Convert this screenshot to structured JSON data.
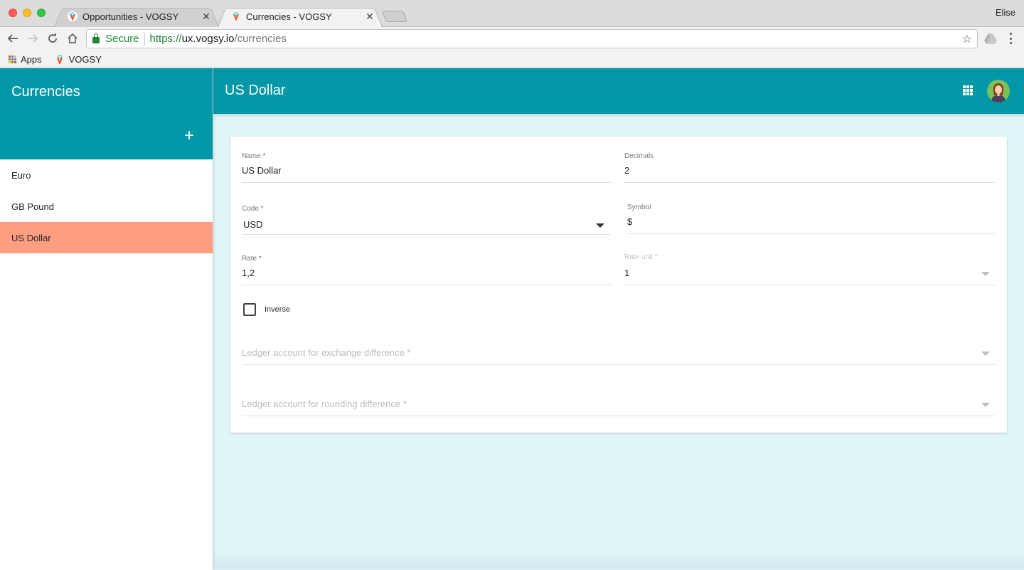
{
  "browser": {
    "tabs": [
      {
        "title": "Opportunities - VOGSY",
        "active": false
      },
      {
        "title": "Currencies - VOGSY",
        "active": true
      }
    ],
    "profile_name": "Elise",
    "address": {
      "security_label": "Secure",
      "scheme": "https://",
      "host": "ux.vogsy.io",
      "path": "/currencies"
    },
    "bookmarks": [
      {
        "label": "Apps",
        "icon": "apps-grid-icon"
      },
      {
        "label": "VOGSY",
        "icon": "vogsy-logo-icon"
      }
    ],
    "close_glyph": "✕",
    "star_glyph": "☆"
  },
  "sidebar": {
    "title": "Currencies",
    "add_glyph": "+",
    "items": [
      {
        "label": "Euro",
        "selected": false
      },
      {
        "label": "GB Pound",
        "selected": false
      },
      {
        "label": "US Dollar",
        "selected": true
      }
    ]
  },
  "header": {
    "title": "US Dollar"
  },
  "form": {
    "name": {
      "label": "Name *",
      "value": "US Dollar"
    },
    "decimals": {
      "label": "Decimals",
      "value": "2"
    },
    "code": {
      "label": "Code *",
      "value": "USD"
    },
    "symbol": {
      "label": "Symbol",
      "value": "$"
    },
    "rate": {
      "label": "Rate *",
      "value": "1,2"
    },
    "rate_unit": {
      "label": "Rate unit *",
      "value": "1"
    },
    "inverse": {
      "label": "Inverse",
      "checked": false
    },
    "ledger_exchange": {
      "placeholder": "Ledger account for exchange difference *"
    },
    "ledger_rounding": {
      "placeholder": "Ledger account for rounding difference *"
    }
  },
  "colors": {
    "primary": "#0097a7",
    "selected_item": "#ff9e80",
    "content_bg": "#dff5f8"
  }
}
